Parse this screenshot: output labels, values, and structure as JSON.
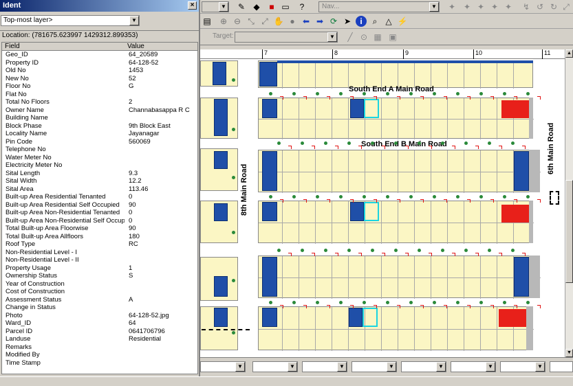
{
  "identify": {
    "title": "Ident",
    "layer": "Top-most layer>",
    "location": "Location: (781675.623997 1429312.899353)",
    "col_field": "Field",
    "col_value": "Value",
    "rows": [
      [
        "Geo_ID",
        "64_20589"
      ],
      [
        "Property ID",
        "64-128-52"
      ],
      [
        "Old No",
        "1453"
      ],
      [
        "New No",
        "52"
      ],
      [
        "Floor No",
        "G"
      ],
      [
        "Flat No",
        ""
      ],
      [
        "Total No Floors",
        "2"
      ],
      [
        "Owner Name",
        "Channabasappa R C"
      ],
      [
        "Building Name",
        ""
      ],
      [
        "Block Phase",
        "9th Block East"
      ],
      [
        "Locality Name",
        "Jayanagar"
      ],
      [
        "Pin Code",
        "560069"
      ],
      [
        "Telephone No",
        ""
      ],
      [
        "Water Meter No",
        ""
      ],
      [
        "Electricity Meter No",
        ""
      ],
      [
        "Sital Length",
        "9.3"
      ],
      [
        "Sital  Width",
        "12.2"
      ],
      [
        "Sital Area",
        "113.46"
      ],
      [
        "Built-up Area Residential Tenanted",
        "0"
      ],
      [
        "Built-up Area Residential Self Occupied",
        "90"
      ],
      [
        "Built-up Area Non-Residential Tenanted",
        "0"
      ],
      [
        "Built-up Area Non-Residential Self Occupied",
        "0"
      ],
      [
        "Total Built-up Area Floorwise",
        "90"
      ],
      [
        "Total Built-up Area Allfloors",
        "180"
      ],
      [
        "Roof Type",
        "RC"
      ],
      [
        "Non-Residential Level - I",
        ""
      ],
      [
        "Non-Residential Level - II",
        ""
      ],
      [
        "Property Usage",
        "1"
      ],
      [
        "Ownership Status",
        "S"
      ],
      [
        "Year of Construction",
        ""
      ],
      [
        "Cost of Construction",
        ""
      ],
      [
        "Assessment Status",
        "A"
      ],
      [
        "Change in Status",
        ""
      ],
      [
        "Photo",
        "64-128-52.jpg"
      ],
      [
        "Ward_ID",
        "64"
      ],
      [
        "Parcel ID",
        "0641706796"
      ],
      [
        "Landuse",
        "Residential"
      ],
      [
        "Remarks",
        ""
      ],
      [
        "Modified By",
        ""
      ],
      [
        "Time Stamp",
        ""
      ]
    ]
  },
  "toolbar": {
    "nav_label": "Nav...",
    "target_label": "Target:"
  },
  "ruler": [
    "7",
    "8",
    "9",
    "10",
    "11"
  ],
  "map": {
    "roads": {
      "south_end_a": "South End A Main Road",
      "south_end_b": "South End B Main Road",
      "eighth_main": "8th Main Road",
      "sixth_main": "6th Main Road"
    }
  },
  "colors": {
    "blue_plot": "#1f4fa8",
    "red_plot": "#e8201a",
    "selected_outline": "#1ad4e0",
    "plot_fill": "#fbf6c4"
  }
}
